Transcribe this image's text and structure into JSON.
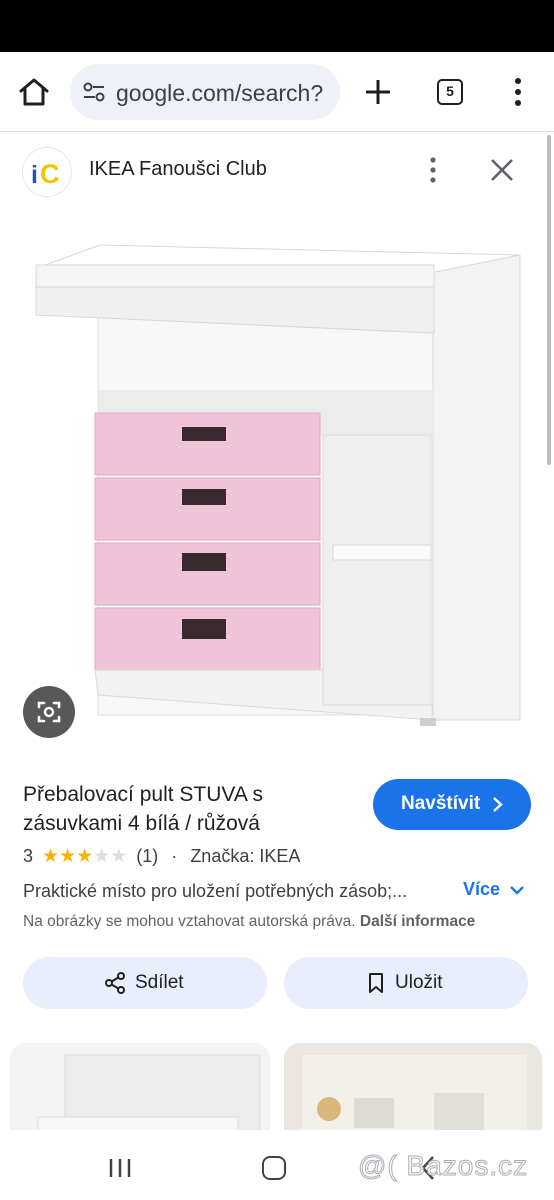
{
  "browser": {
    "url": "google.com/search?",
    "tab_count": "5"
  },
  "site": {
    "logo_text": "iC",
    "name": "IKEA Fanoušci Club"
  },
  "product": {
    "title": "Přebalovací pult STUVA s zásuvkami 4 bílá / růžová",
    "visit_label": "Navštívit",
    "rating_value": "3",
    "rating_stars": 3,
    "rating_max": 5,
    "review_count": "(1)",
    "separator": "·",
    "brand": "Značka: IKEA",
    "description": "Praktické místo pro uložení potřebných zásob;...",
    "more_label": "Více",
    "copyright_text": "Na obrázky se mohou vztahovat autorská práva.",
    "copyright_link": "Další informace"
  },
  "actions": {
    "share_label": "Sdílet",
    "save_label": "Uložit"
  },
  "watermark": "@( Bazos.cz",
  "colors": {
    "accent": "#1a73e8",
    "button_bg": "#e8eefb",
    "star": "#f5b400",
    "drawer_pink": "#efc3d8"
  }
}
